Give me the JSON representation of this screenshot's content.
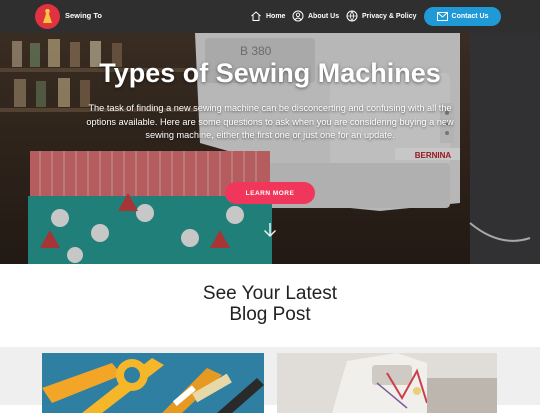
{
  "brand": {
    "name": "Sewing To"
  },
  "nav": {
    "items": [
      {
        "label": "Home",
        "icon": "home-icon"
      },
      {
        "label": "About Us",
        "icon": "user-icon"
      },
      {
        "label": "Privacy & Policy",
        "icon": "globe-icon"
      }
    ],
    "contact_label": "Contact Us",
    "contact_icon": "envelope-icon"
  },
  "hero": {
    "title": "Types of Sewing Machines",
    "text": "The task of finding a new sewing machine can be disconcerting and confusing with all the options available. Here are some questions to ask when you are considering buying a new sewing machine, either the first one or just one for an update.",
    "button_label": "LEARN MORE",
    "scroll_icon": "chevron-down-icon",
    "machine_model": "B 380",
    "machine_brand": "BERNINA"
  },
  "blog": {
    "title_line1": "See Your Latest",
    "title_line2": "Blog Post"
  },
  "colors": {
    "navbar": "#2f2f2f",
    "accent_blue": "#1f9ad6",
    "accent_pink": "#f0365a",
    "logo_red": "#e0323f"
  }
}
